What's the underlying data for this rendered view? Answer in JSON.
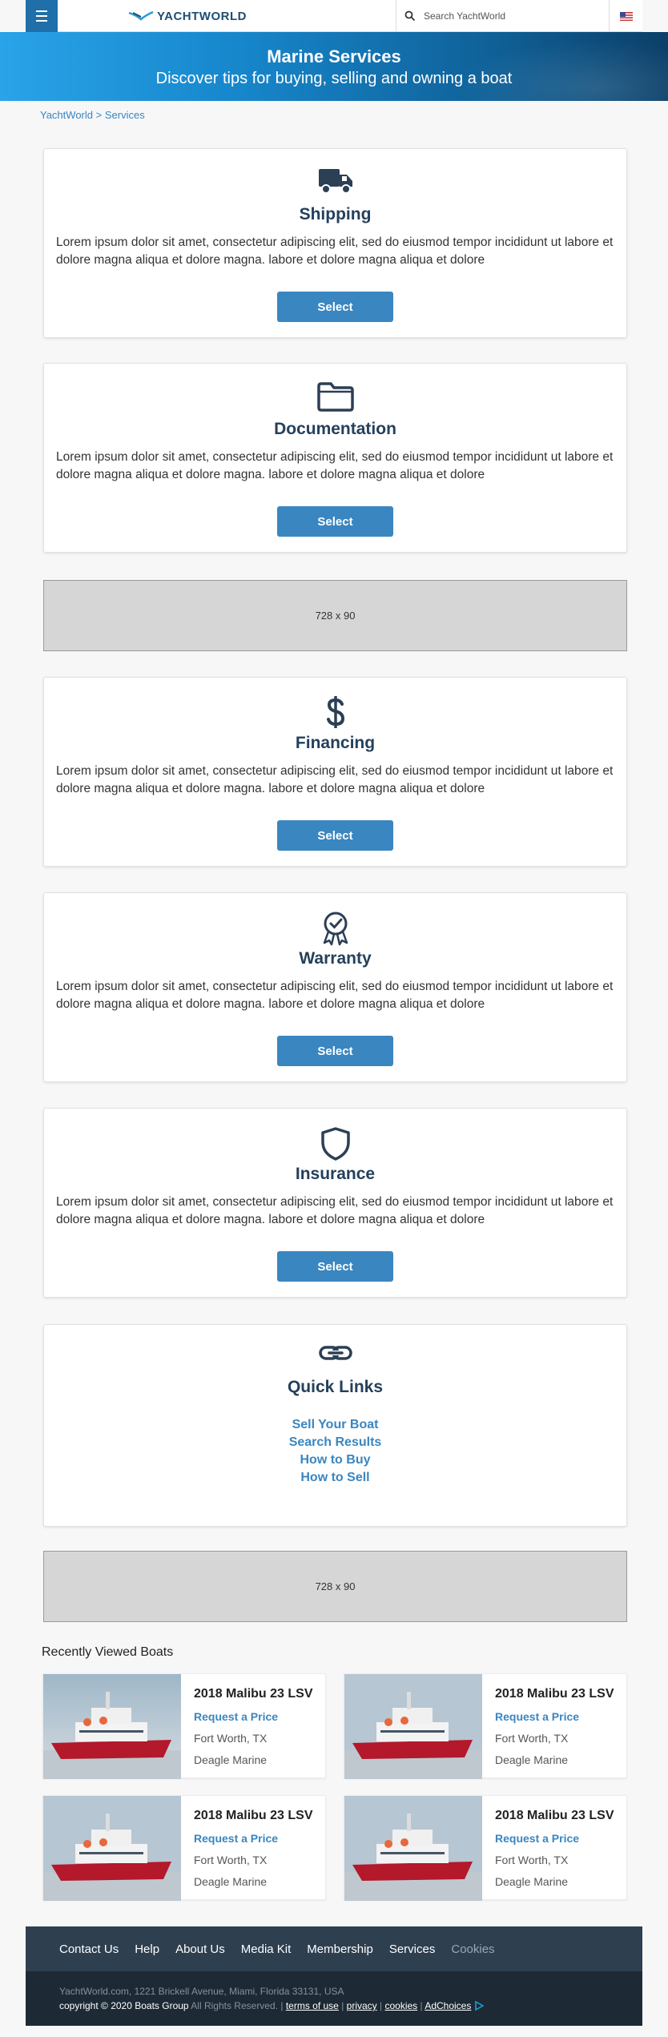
{
  "header": {
    "logo_text": "YACHTWORLD",
    "search_placeholder": "Search YachtWorld"
  },
  "hero": {
    "title": "Marine Services",
    "subtitle": "Discover tips for buying, selling and owning a boat"
  },
  "breadcrumb": {
    "home": "YachtWorld",
    "separator": ">",
    "current": "Services"
  },
  "services": [
    {
      "icon": "truck-icon",
      "title": "Shipping",
      "body": "Lorem ipsum dolor sit amet, consectetur adipiscing elit, sed do eiusmod tempor incididunt ut labore et dolore magna aliqua et dolore magna.  labore et dolore magna aliqua et dolore",
      "button": "Select"
    },
    {
      "icon": "folder-icon",
      "title": "Documentation",
      "body": "Lorem ipsum dolor sit amet, consectetur adipiscing elit, sed do eiusmod tempor incididunt ut labore et dolore magna aliqua et dolore magna.  labore et dolore magna aliqua et dolore",
      "button": "Select"
    },
    {
      "icon": "dollar-icon",
      "title": "Financing",
      "body": "Lorem ipsum dolor sit amet, consectetur adipiscing elit, sed do eiusmod tempor incididunt ut labore et dolore magna aliqua et dolore magna.  labore et dolore magna aliqua et dolore",
      "button": "Select"
    },
    {
      "icon": "award-ribbon-icon",
      "title": "Warranty",
      "body": "Lorem ipsum dolor sit amet, consectetur adipiscing elit, sed do eiusmod tempor incididunt ut labore et dolore magna aliqua et dolore magna.  labore et dolore magna aliqua et dolore",
      "button": "Select"
    },
    {
      "icon": "shield-icon",
      "title": "Insurance",
      "body": "Lorem ipsum dolor sit amet, consectetur adipiscing elit, sed do eiusmod tempor incididunt ut labore et dolore magna aliqua et dolore magna.  labore et dolore magna aliqua et dolore",
      "button": "Select"
    }
  ],
  "ads": [
    "728 x 90",
    "728 x 90"
  ],
  "quick_links": {
    "icon": "link-icon",
    "title": "Quick Links",
    "links": [
      "Sell Your Boat",
      "Search Results",
      "How to Buy",
      "How to Sell"
    ]
  },
  "recently_viewed": {
    "title": "Recently Viewed Boats",
    "boats": [
      {
        "name": "2018 Malibu 23 LSV",
        "cta": "Request a Price",
        "location": "Fort Worth, TX",
        "dealer": "Deagle Marine"
      },
      {
        "name": "2018 Malibu 23 LSV",
        "cta": "Request a Price",
        "location": "Fort Worth, TX",
        "dealer": "Deagle Marine"
      },
      {
        "name": "2018 Malibu 23 LSV",
        "cta": "Request a Price",
        "location": "Fort Worth, TX",
        "dealer": "Deagle Marine"
      },
      {
        "name": "2018 Malibu 23 LSV",
        "cta": "Request a Price",
        "location": "Fort Worth, TX",
        "dealer": "Deagle Marine"
      }
    ]
  },
  "footer": {
    "nav": [
      "Contact Us",
      "Help",
      "About Us",
      "Media Kit",
      "Membership",
      "Services",
      "Cookies"
    ],
    "address": "YachtWorld.com, 1221 Brickell Avenue, Miami, Florida 33131, USA",
    "copyright": "copyright © 2020 Boats Group",
    "rights": "All Rights Reserved.",
    "sep": "|",
    "legal_links": [
      "terms of use",
      "privacy",
      "cookies",
      "AdChoices"
    ]
  },
  "colors": {
    "accent": "#3a86c0",
    "heading": "#24405c",
    "menu": "#1f6fa8",
    "footer_top": "#2e3f50",
    "footer_bottom": "#1d2a36"
  }
}
